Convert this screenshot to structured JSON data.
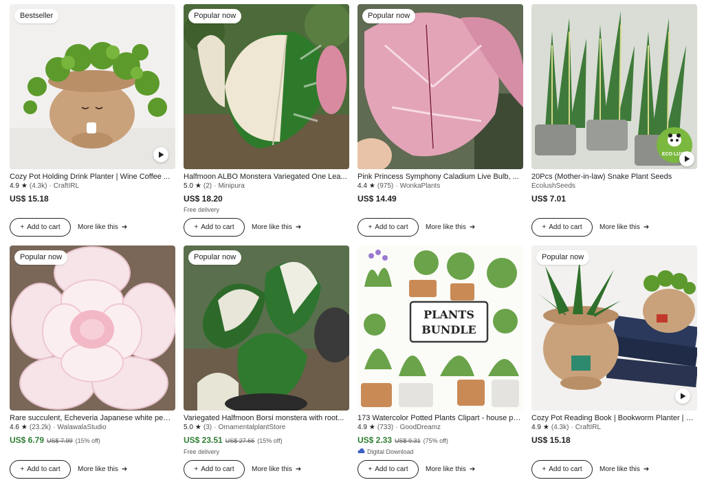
{
  "colors": {
    "sale": "#2e7d32",
    "text": "#222222",
    "muted": "#595959"
  },
  "listings": [
    {
      "badge": "Bestseller",
      "has_video": true,
      "title": "Cozy Pot Holding Drink Planter | Wine Coffee ...",
      "rating": "4.9",
      "reviews": "(4.3k)",
      "shop": "CraftIRL",
      "price": "US$ 15.18",
      "original_price": "",
      "discount": "",
      "note": "",
      "add_label": "Add to cart",
      "more_label": "More like this"
    },
    {
      "badge": "Popular now",
      "has_video": false,
      "title": "Halfmoon ALBO Monstera Variegated One Lea...",
      "rating": "5.0",
      "reviews": "(2)",
      "shop": "Minipura",
      "price": "US$ 18.20",
      "original_price": "",
      "discount": "",
      "note": "Free delivery",
      "add_label": "Add to cart",
      "more_label": "More like this"
    },
    {
      "badge": "Popular now",
      "has_video": false,
      "title": "Pink Princess Symphony Caladium Live Bulb, ...",
      "rating": "4.4",
      "reviews": "(975)",
      "shop": "WonkaPlants",
      "price": "US$ 14.49",
      "original_price": "",
      "discount": "",
      "note": "",
      "add_label": "Add to cart",
      "more_label": "More like this"
    },
    {
      "badge": "",
      "has_video": true,
      "logo_text": "ECO LUSH",
      "title": "20Pcs (Mother-in-law) Snake Plant Seeds",
      "rating": "",
      "reviews": "",
      "shop": "EcolushSeeds",
      "price": "US$ 7.01",
      "original_price": "",
      "discount": "",
      "note": "",
      "add_label": "Add to cart",
      "more_label": "More like this"
    },
    {
      "badge": "Popular now",
      "has_video": false,
      "title": "Rare succulent, Echeveria Japanese white pea...",
      "rating": "4.6",
      "reviews": "(23.2k)",
      "shop": "WalawalaStudio",
      "price": "US$ 6.79",
      "original_price": "US$ 7.99",
      "discount": "(15% off)",
      "note": "",
      "add_label": "Add to cart",
      "more_label": "More like this"
    },
    {
      "badge": "Popular now",
      "has_video": false,
      "title": "Variegated Halfmoon Borsi monstera with root...",
      "rating": "5.0",
      "reviews": "(3)",
      "shop": "OrnamentalplantStore",
      "price": "US$ 23.51",
      "original_price": "US$ 27.66",
      "discount": "(15% off)",
      "note": "Free delivery",
      "add_label": "Add to cart",
      "more_label": "More like this"
    },
    {
      "badge": "",
      "has_video": false,
      "bundle_text": [
        "PLANTS",
        "BUNDLE"
      ],
      "title": "173 Watercolor Potted Plants Clipart - house pl...",
      "rating": "4.9",
      "reviews": "(733)",
      "shop": "GoodDreamz",
      "price": "US$ 2.33",
      "original_price": "US$ 9.31",
      "discount": "(75% off)",
      "note": "Digital Download",
      "add_label": "Add to cart",
      "more_label": "More like this"
    },
    {
      "badge": "Popular now",
      "has_video": true,
      "title": "Cozy Pot Reading Book | Bookworm Planter | G...",
      "rating": "4.9",
      "reviews": "(4.3k)",
      "shop": "CraftIRL",
      "price": "US$ 15.18",
      "original_price": "",
      "discount": "",
      "note": "",
      "add_label": "Add to cart",
      "more_label": "More like this"
    }
  ]
}
